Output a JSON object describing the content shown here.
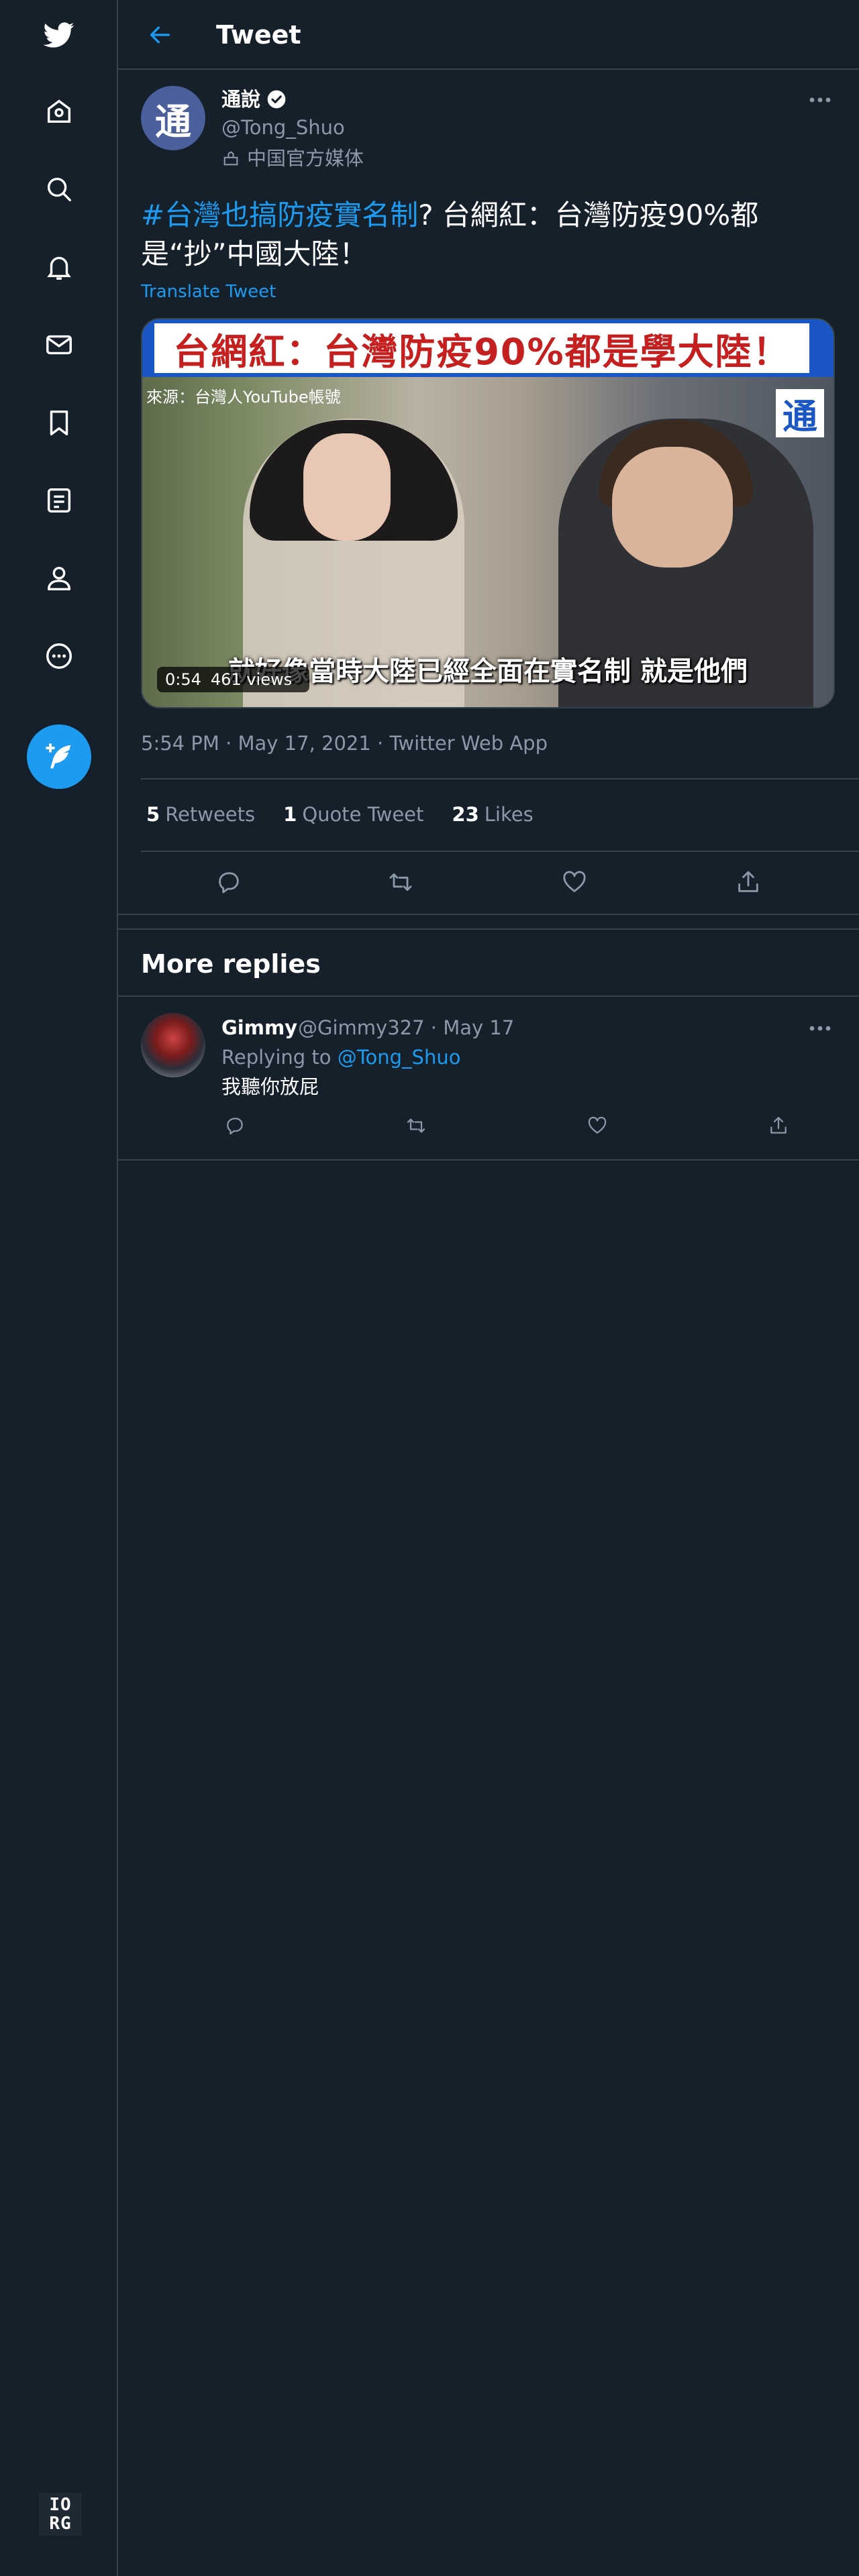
{
  "nav": {
    "items": [
      "twitter-logo",
      "home",
      "explore",
      "notifications",
      "messages",
      "bookmarks",
      "lists",
      "profile",
      "more"
    ],
    "tweet_button": "compose"
  },
  "header": {
    "title": "Tweet"
  },
  "tweet": {
    "author_name": "通說",
    "handle": "@Tong_Shuo",
    "affiliation": "中国官方媒体",
    "text_hashtag": "#台灣也搞防疫實名制",
    "text_rest": "? 台網紅：台灣防疫90%都是“抄”中國大陸！",
    "translate_label": "Translate Tweet",
    "media": {
      "banner_text": "台網紅：台灣防疫90%都是學大陸！",
      "source_text": "來源：台灣人YouTube帳號",
      "logo_glyph": "通",
      "subtitle": "就好像當時大陸已經全面在實名制 就是他們",
      "duration": "0:54",
      "views": "461 views"
    },
    "timestamp": "5:54 PM · May 17, 2021 · Twitter Web App",
    "stats": {
      "retweets_count": "5",
      "retweets_label": "Retweets",
      "quotes_count": "1",
      "quotes_label": "Quote Tweet",
      "likes_count": "23",
      "likes_label": "Likes"
    }
  },
  "more_replies": {
    "title": "More replies",
    "reply": {
      "name": "Gimmy",
      "meta": "@Gimmy327 · May 17",
      "replying_prefix": "Replying to",
      "replying_handle": "@Tong_Shuo",
      "text": "我聽你放屁"
    }
  },
  "footer": {
    "badge_line1": "IO",
    "badge_line2": "RG"
  },
  "colors": {
    "background": "#15202b",
    "accent": "#1d9bf0",
    "border": "#38444d",
    "muted": "#8b98a5"
  }
}
